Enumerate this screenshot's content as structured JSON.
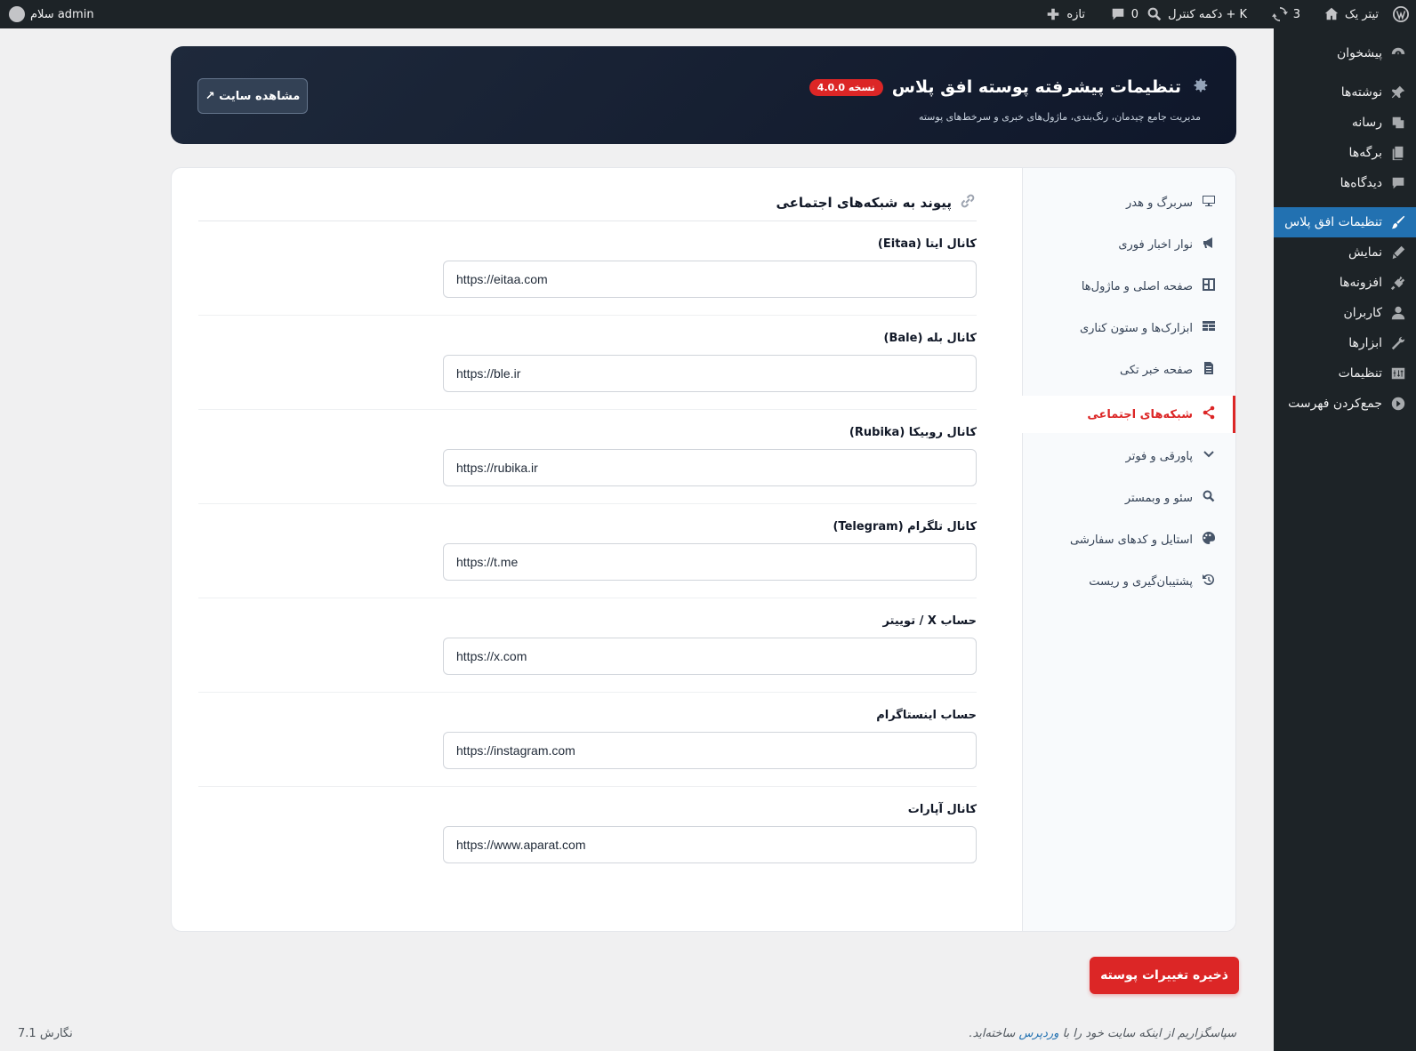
{
  "adminbar": {
    "site_name": "تیتر یک",
    "updates_count": "3",
    "search_label": "دکمه کنترل + K",
    "comments_count": "0",
    "new_label": "تازه",
    "greeting": "سلام admin"
  },
  "menu": {
    "items": [
      {
        "label": "پیشخوان",
        "icon": "dashboard-icon"
      },
      {
        "label": "نوشته‌ها",
        "icon": "pin-icon"
      },
      {
        "label": "رسانه",
        "icon": "media-icon"
      },
      {
        "label": "برگه‌ها",
        "icon": "pages-icon"
      },
      {
        "label": "دیدگاه‌ها",
        "icon": "comments-icon"
      },
      {
        "label": "تنظیمات افق پلاس",
        "icon": "brush-icon"
      },
      {
        "label": "نمایش",
        "icon": "appearance-icon"
      },
      {
        "label": "افزونه‌ها",
        "icon": "plugins-icon"
      },
      {
        "label": "کاربران",
        "icon": "users-icon"
      },
      {
        "label": "ابزارها",
        "icon": "tools-icon"
      },
      {
        "label": "تنظیمات",
        "icon": "settings-icon"
      },
      {
        "label": "جمع‌کردن فهرست",
        "icon": "collapse-icon"
      }
    ]
  },
  "header": {
    "title": "تنظیمات پیشرفته پوسته افق پلاس",
    "version": "نسخه 4.0.0",
    "subtitle": "مدیریت جامع چیدمان، رنگ‌بندی، ماژول‌های خبری و سرخط‌های پوسته",
    "view_site": "مشاهده سایت ↗"
  },
  "nav": {
    "items": [
      {
        "label": "سربرگ و هدر",
        "icon": "monitor-icon"
      },
      {
        "label": "نوار اخبار فوری",
        "icon": "megaphone-icon"
      },
      {
        "label": "صفحه اصلی و ماژول‌ها",
        "icon": "layout-icon"
      },
      {
        "label": "ابزارک‌ها و ستون کناری",
        "icon": "table-icon"
      },
      {
        "label": "صفحه خبر تکی",
        "icon": "document-icon"
      },
      {
        "label": "شبکه‌های اجتماعی",
        "icon": "share-icon"
      },
      {
        "label": "پاورقی و فوتر",
        "icon": "chevron-down-icon"
      },
      {
        "label": "سئو و وبمستر",
        "icon": "search-icon"
      },
      {
        "label": "استایل و کدهای سفارشی",
        "icon": "palette-icon"
      },
      {
        "label": "پشتیبان‌گیری و ریست",
        "icon": "history-icon"
      }
    ]
  },
  "section": {
    "title": "پیوند به شبکه‌های اجتماعی",
    "fields": [
      {
        "label": "کانال ایتا (Eitaa)",
        "value": "https://eitaa.com"
      },
      {
        "label": "کانال بله (Bale)",
        "value": "https://ble.ir"
      },
      {
        "label": "کانال روبیکا (Rubika)",
        "value": "https://rubika.ir"
      },
      {
        "label": "کانال تلگرام (Telegram)",
        "value": "https://t.me"
      },
      {
        "label": "حساب X / توییتر",
        "value": "https://x.com"
      },
      {
        "label": "حساب اینستاگرام",
        "value": "https://instagram.com"
      },
      {
        "label": "کانال آپارات",
        "value": "https://www.aparat.com"
      }
    ]
  },
  "save_label": "ذخیره تغییرات پوسته",
  "footer": {
    "thanks_before": "سپاسگزاریم از اینکه سایت خود را با ",
    "wp_link": "وردپرس",
    "thanks_after": " ساخته‌اید.",
    "version": "نگارش 7.1"
  },
  "colors": {
    "accent": "#dc2626",
    "wp_blue": "#2271b1",
    "admin_dark": "#1d2327"
  }
}
